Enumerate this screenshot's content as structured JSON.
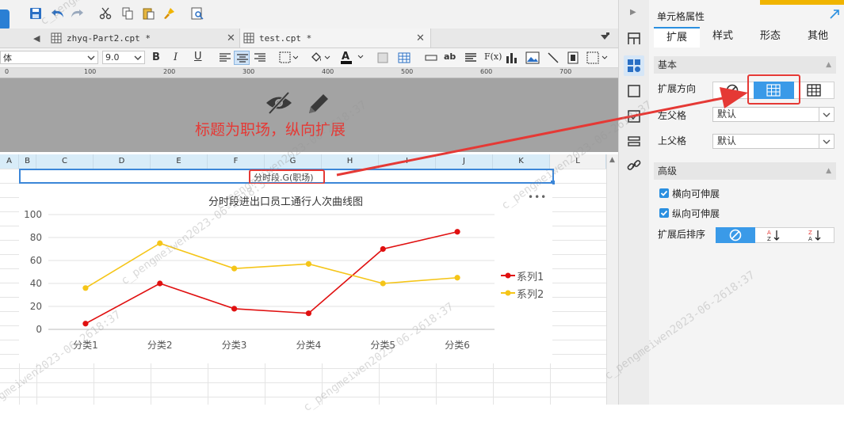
{
  "tabs": [
    {
      "label": "zhyq-Part2.cpt *"
    },
    {
      "label": "test.cpt *"
    }
  ],
  "format": {
    "font_name": "体",
    "font_size": "9.0"
  },
  "ruler": {
    "ticks": [
      "0",
      "100",
      "200",
      "300",
      "400",
      "500",
      "600",
      "700"
    ]
  },
  "annotation": {
    "text": "标题为职场，纵向扩展",
    "color": "#e53935"
  },
  "columns": [
    "A",
    "B",
    "C",
    "D",
    "E",
    "F",
    "G",
    "H",
    "I",
    "J",
    "K",
    "L"
  ],
  "cell": {
    "text": "分时段.G(职场)"
  },
  "chart_data": {
    "type": "line",
    "title": "分时段进出口员工通行人次曲线图",
    "categories": [
      "分类1",
      "分类2",
      "分类3",
      "分类4",
      "分类5",
      "分类6"
    ],
    "series": [
      {
        "name": "系列1",
        "color": "#e01010",
        "values": [
          5,
          40,
          18,
          14,
          70,
          85
        ]
      },
      {
        "name": "系列2",
        "color": "#f5c518",
        "values": [
          36,
          75,
          53,
          57,
          40,
          45
        ]
      }
    ],
    "yticks": [
      "0",
      "20",
      "40",
      "60",
      "80",
      "100"
    ],
    "ylim": [
      0,
      100
    ],
    "grid": true,
    "legend": "right",
    "menu": "•••"
  },
  "panel": {
    "title": "单元格属性",
    "tabs": [
      "扩展",
      "样式",
      "形态",
      "其他"
    ],
    "basic": {
      "header": "基本",
      "expand_dir_label": "扩展方向",
      "left_parent_label": "左父格",
      "left_parent_value": "默认",
      "upper_parent_label": "上父格",
      "upper_parent_value": "默认"
    },
    "advanced": {
      "header": "高级",
      "horizontal": "横向可伸展",
      "vertical": "纵向可伸展",
      "sort_label": "扩展后排序"
    }
  },
  "watermark": "c_pengmeiwen2023-06-2618:37",
  "colors": {
    "accent": "#2a8fe0",
    "highlight": "#e53935"
  }
}
